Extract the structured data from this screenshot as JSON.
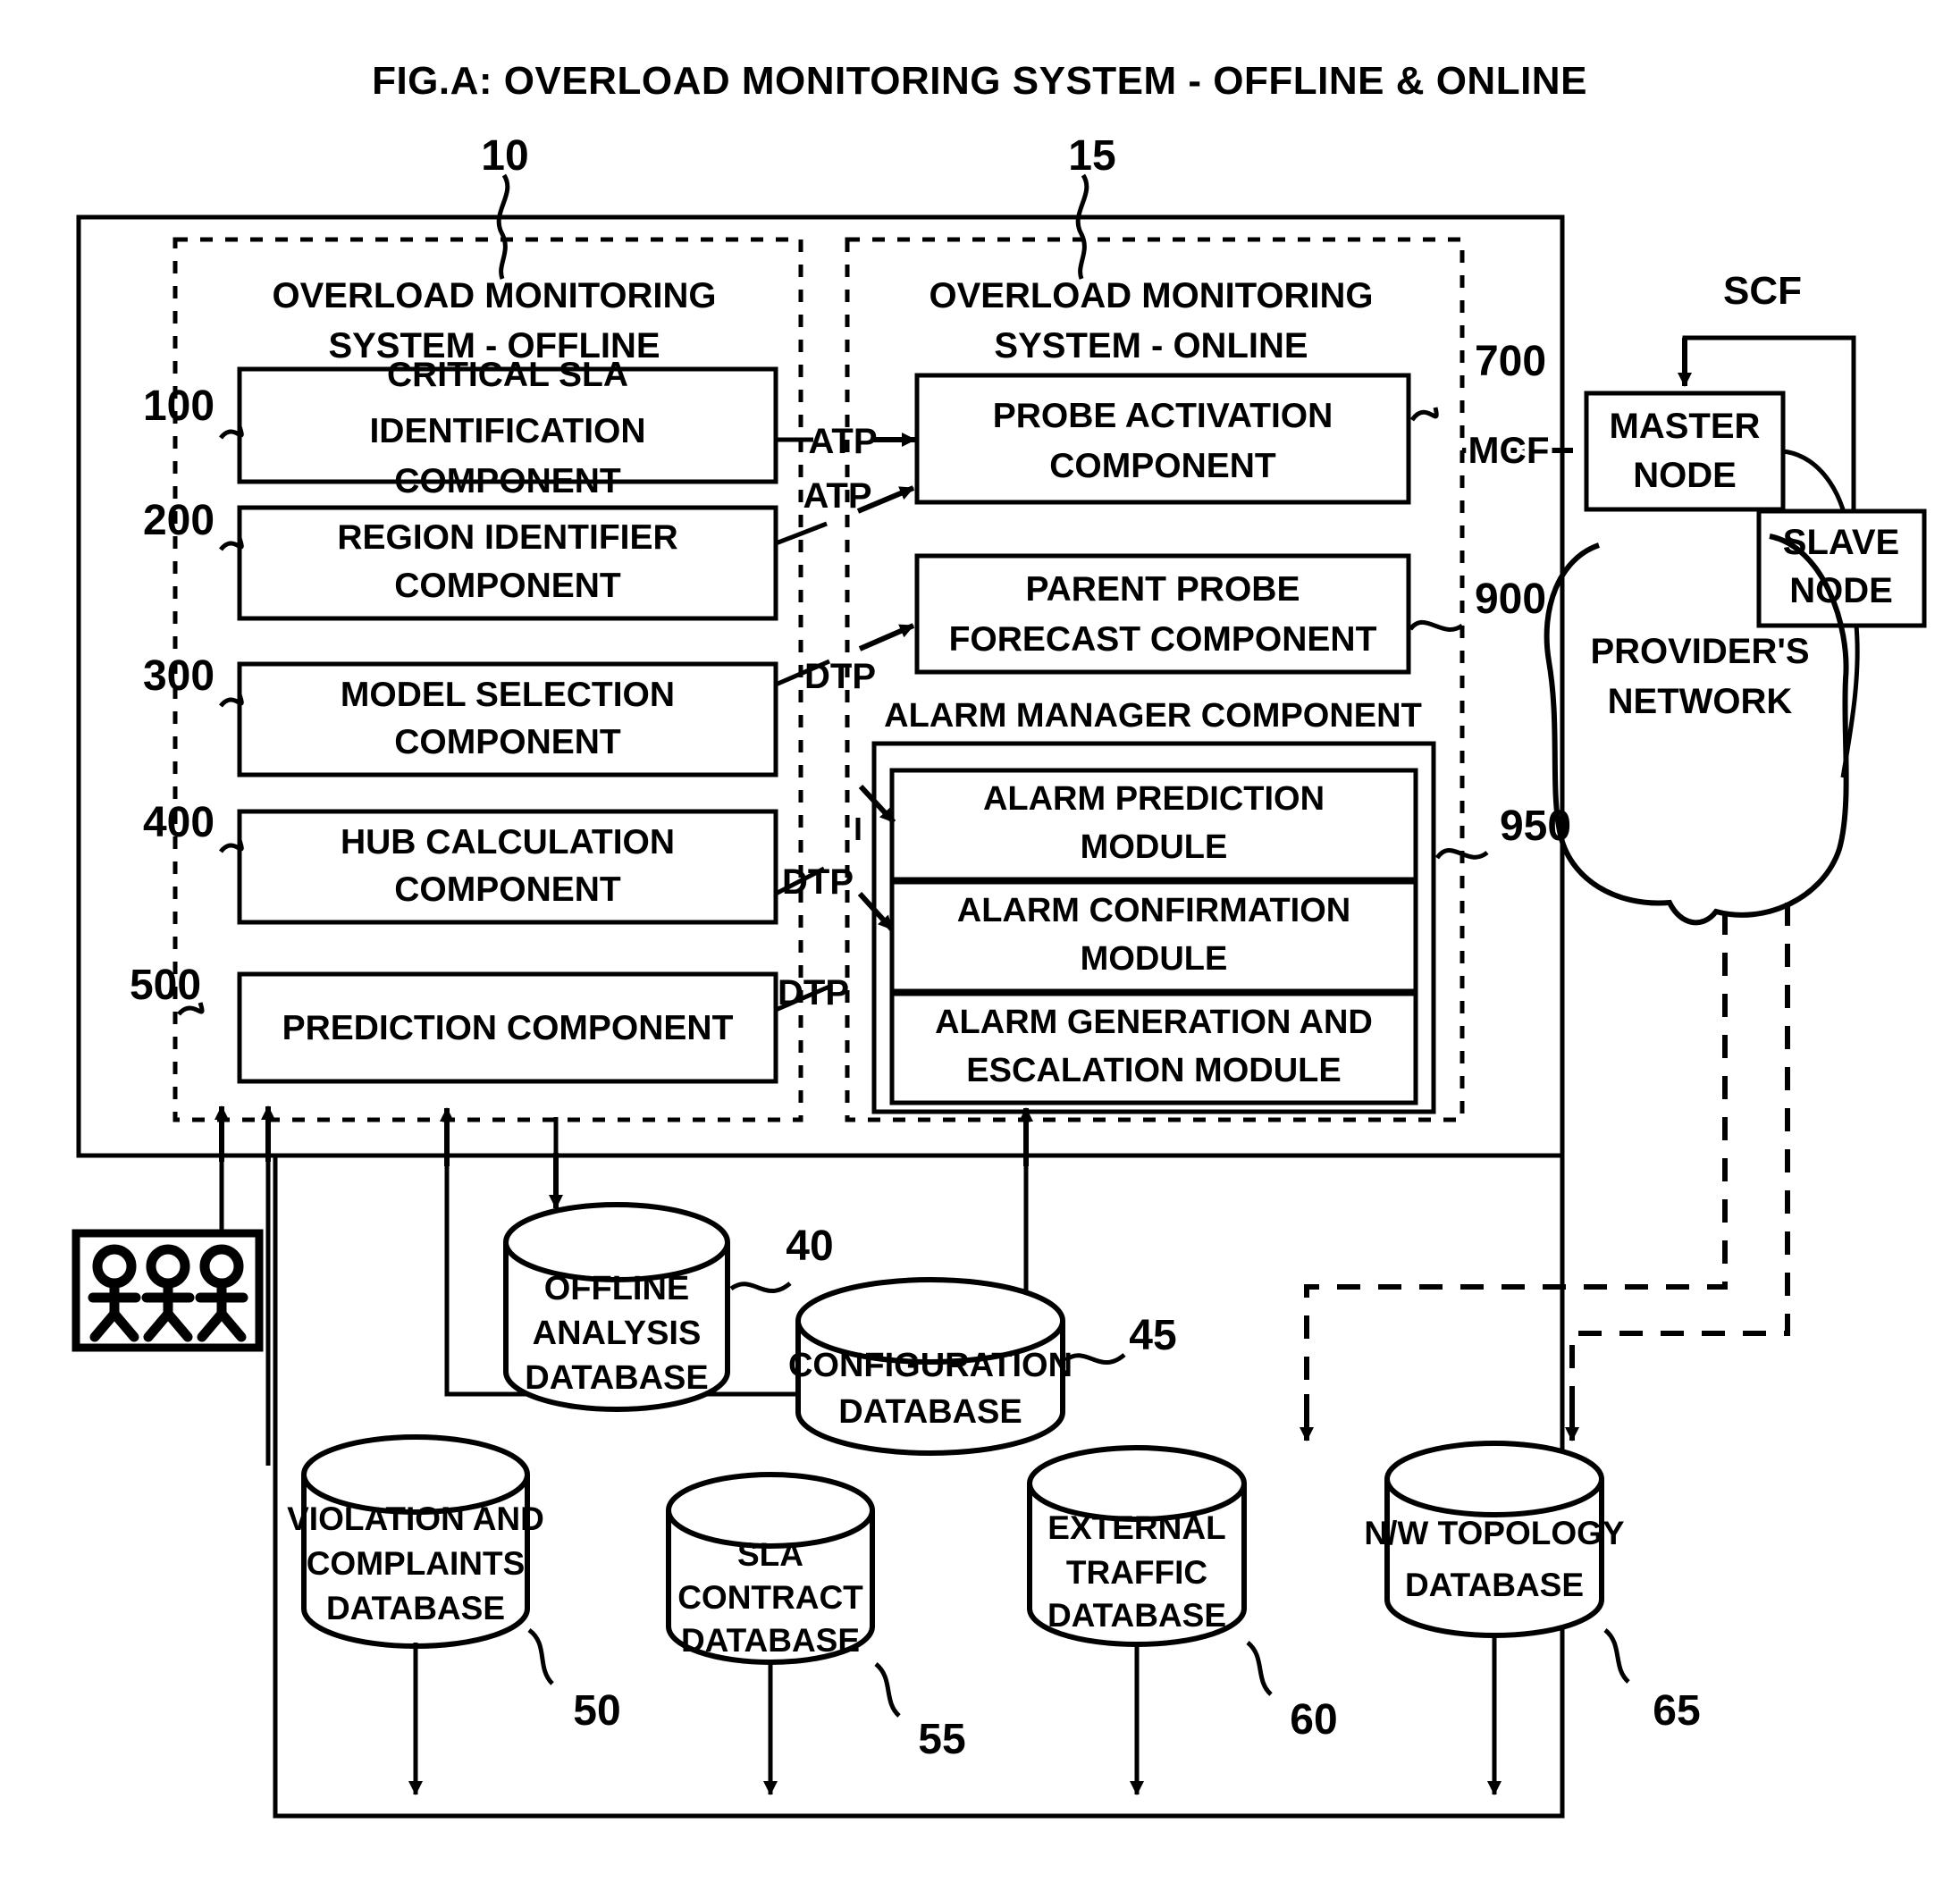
{
  "figure": {
    "title": "FIG.A: OVERLOAD MONITORING SYSTEM - OFFLINE  & ONLINE"
  },
  "offline_group": {
    "ref": "10",
    "heading_line1": "OVERLOAD MONITORING",
    "heading_line2": "SYSTEM - OFFLINE",
    "components": [
      {
        "ref": "100",
        "line1": "CRITICAL SLA",
        "line2": "IDENTIFICATION",
        "line3": "COMPONENT"
      },
      {
        "ref": "200",
        "line1": "REGION IDENTIFIER",
        "line2": "COMPONENT",
        "line3": ""
      },
      {
        "ref": "300",
        "line1": "MODEL SELECTION",
        "line2": "COMPONENT",
        "line3": ""
      },
      {
        "ref": "400",
        "line1": "HUB CALCULATION",
        "line2": "COMPONENT",
        "line3": ""
      },
      {
        "ref": "500",
        "line1": "PREDICTION COMPONENT",
        "line2": "",
        "line3": ""
      }
    ]
  },
  "online_group": {
    "ref": "15",
    "heading_line1": "OVERLOAD MONITORING",
    "heading_line2": "SYSTEM - ONLINE",
    "probe_activation": {
      "ref": "700",
      "line1": "PROBE ACTIVATION",
      "line2": "COMPONENT"
    },
    "parent_probe": {
      "ref": "900",
      "line1": "PARENT PROBE",
      "line2": "FORECAST COMPONENT"
    },
    "alarm_manager": {
      "ref": "950",
      "label": "ALARM MANAGER COMPONENT",
      "modules": [
        {
          "line1": "ALARM PREDICTION",
          "line2": "MODULE"
        },
        {
          "line1": "ALARM CONFIRMATION",
          "line2": "MODULE"
        },
        {
          "line1": "ALARM GENERATION AND",
          "line2": "ESCALATION MODULE"
        }
      ]
    }
  },
  "flow_labels": {
    "atp_top": "ATP",
    "atp_second": "ATP",
    "dtp_parent": "DTP",
    "dtp_prediction": "DTP",
    "dtp_confirmation": "DTP",
    "mcf": "MCF",
    "scf": "SCF"
  },
  "network": {
    "master_node_line1": "MASTER",
    "master_node_line2": "NODE",
    "slave_node_line1": "SLAVE",
    "slave_node_line2": "NODE",
    "cloud_line1": "PROVIDER'S",
    "cloud_line2": "NETWORK"
  },
  "users_box": {
    "icon": "three-users-icon"
  },
  "databases": [
    {
      "ref": "40",
      "lines": [
        "OFFLINE",
        "ANALYSIS",
        "DATABASE"
      ]
    },
    {
      "ref": "45",
      "lines": [
        "CONFIGURATION",
        "DATABASE"
      ]
    },
    {
      "ref": "50",
      "lines": [
        "VIOLATION AND",
        "COMPLAINTS",
        "DATABASE"
      ]
    },
    {
      "ref": "55",
      "lines": [
        "SLA",
        "CONTRACT",
        "DATABASE"
      ]
    },
    {
      "ref": "60",
      "lines": [
        "EXTERNAL",
        "TRAFFIC",
        "DATABASE"
      ]
    },
    {
      "ref": "65",
      "lines": [
        "N/W TOPOLOGY",
        "DATABASE"
      ]
    }
  ],
  "colors": {
    "ink": "#000000",
    "paper": "#ffffff"
  }
}
